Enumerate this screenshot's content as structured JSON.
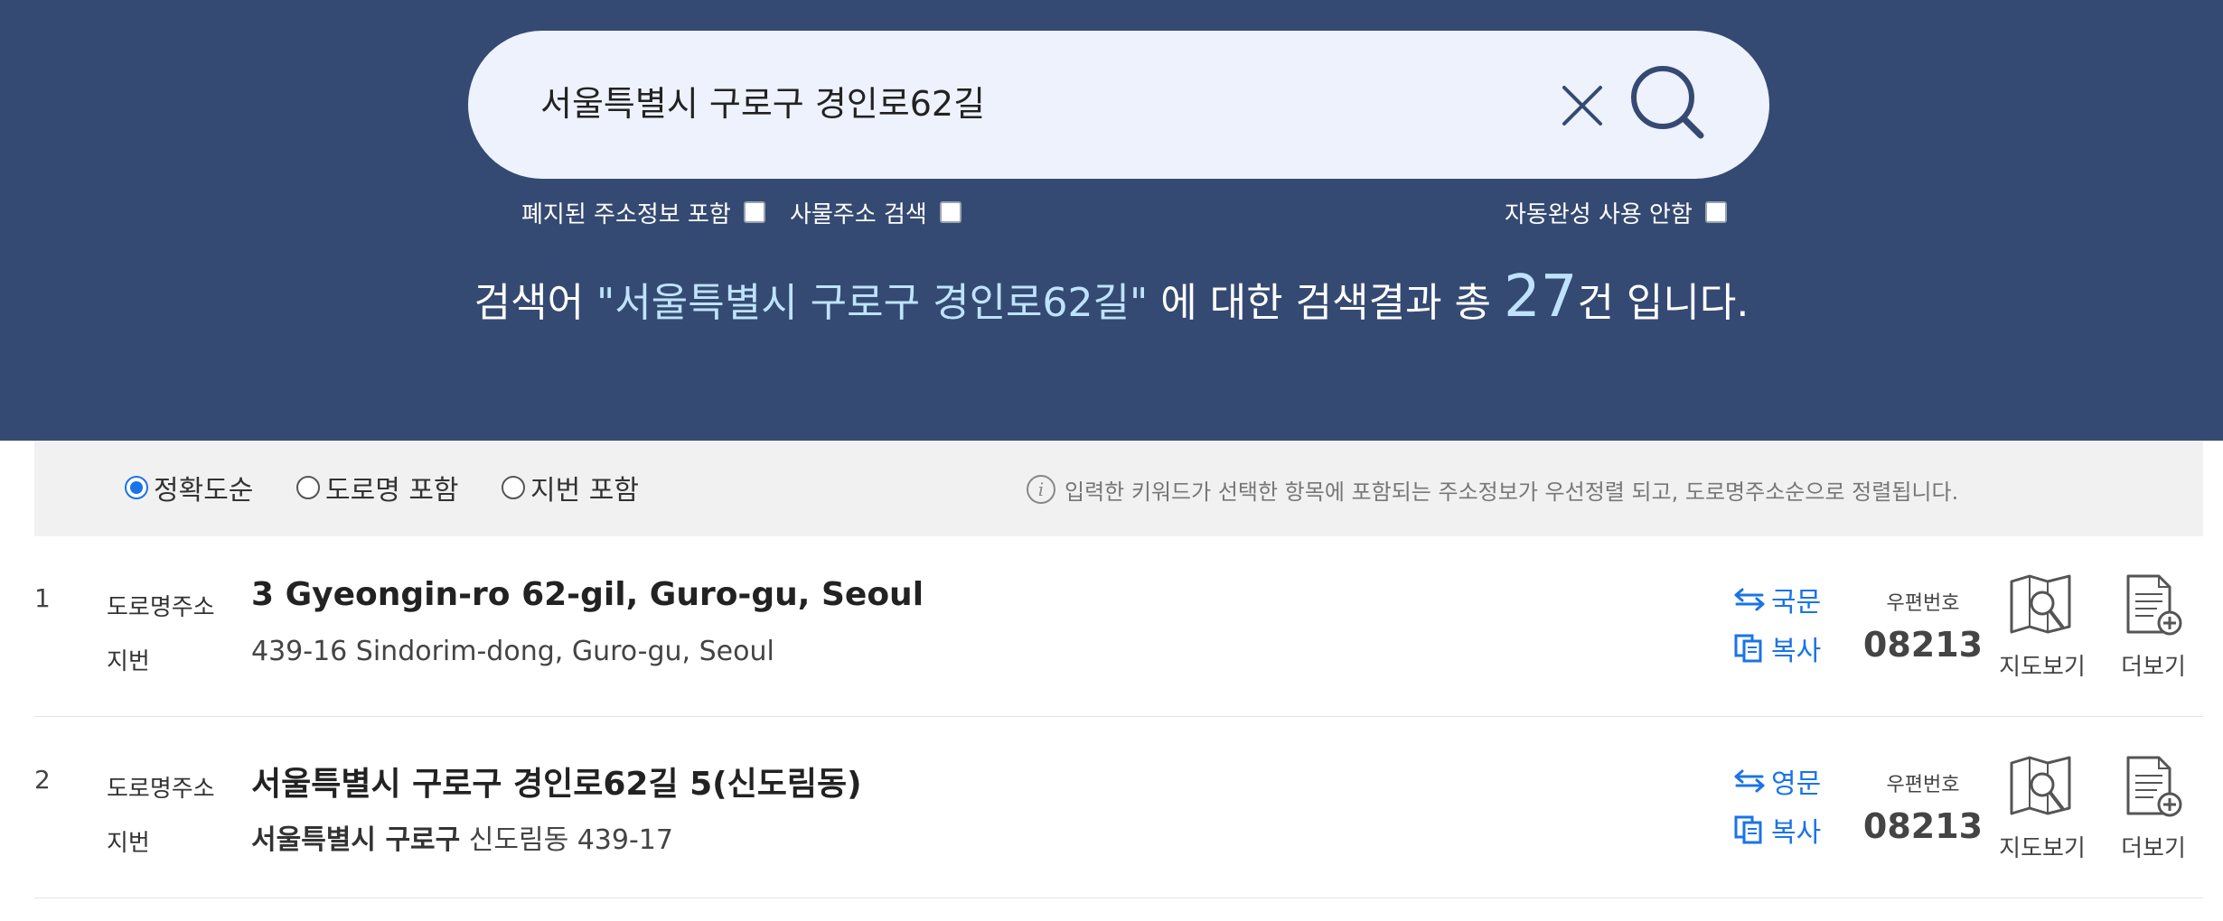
{
  "search": {
    "query": "서울특별시 구로구 경인로62길",
    "options": {
      "abolished": "폐지된 주소정보 포함",
      "building": "사물주소 검색",
      "no_autocomplete": "자동완성 사용 안함"
    },
    "summary": {
      "prefix": "검색어 ",
      "keyword": "\"서울특별시 구로구 경인로62길\"",
      "middle": " 에 대한 검색결과 총 ",
      "count": "27",
      "suffix": "건 입니다."
    }
  },
  "sort": {
    "options": [
      "정확도순",
      "도로명 포함",
      "지번 포함"
    ],
    "selected": "정확도순",
    "hint": "입력한 키워드가 선택한 항목에 포함되는 주소정보가 우선정렬 되고, 도로명주소순으로 정렬됩니다."
  },
  "labels": {
    "road": "도로명주소",
    "jibun": "지번",
    "copy": "복사",
    "zip": "우편번호",
    "map": "지도보기",
    "more": "더보기"
  },
  "results": [
    {
      "num": "1",
      "road": "3 Gyeongin-ro 62-gil, Guro-gu, Seoul",
      "jibun_bold": "",
      "jibun_rest": "439-16 Sindorim-dong, Guro-gu, Seoul",
      "toggle": "국문",
      "zip": "08213"
    },
    {
      "num": "2",
      "road": "서울특별시 구로구 경인로62길 5(신도림동)",
      "jibun_bold": "서울특별시 구로구",
      "jibun_rest": " 신도림동 439-17",
      "toggle": "영문",
      "zip": "08213"
    }
  ],
  "colors": {
    "header_bg": "#354a72",
    "search_bg": "#edf2fc",
    "accent": "#1a73e8",
    "keyword": "#bfe3ff"
  }
}
